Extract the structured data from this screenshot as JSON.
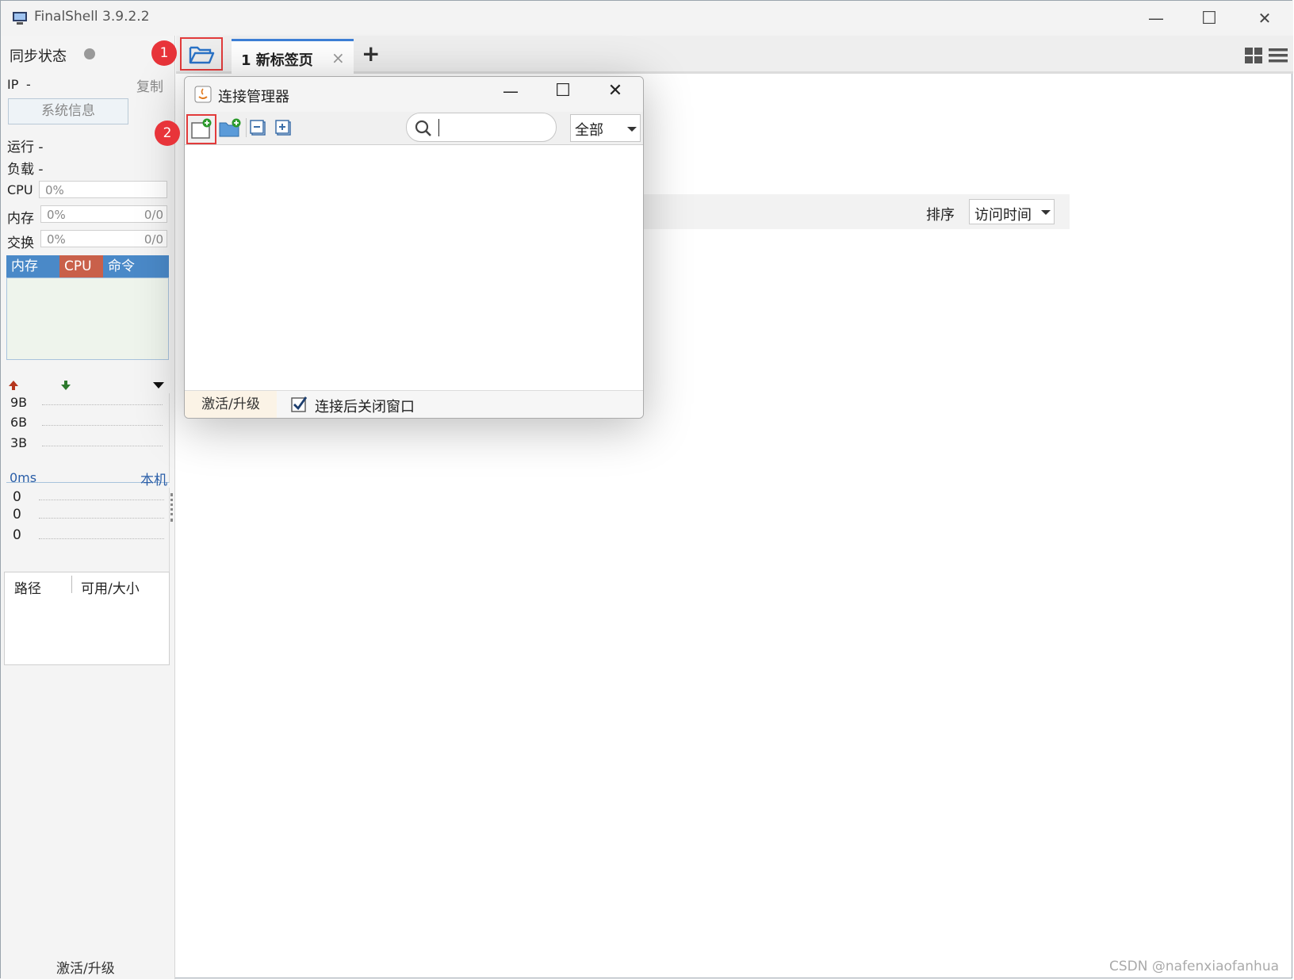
{
  "window": {
    "title": "FinalShell 3.9.2.2",
    "controls": {
      "minimize": "—",
      "maximize": "☐",
      "close": "✕"
    }
  },
  "sidebar": {
    "sync_status_label": "同步状态",
    "ip_label": "IP",
    "ip_value": "-",
    "copy_label": "复制",
    "system_info_button": "系统信息",
    "uptime_label": "运行 -",
    "load_label": "负载 -",
    "cpu_label": "CPU",
    "cpu_value": "0%",
    "mem_label": "内存",
    "mem_value": "0%",
    "mem_total": "0/0",
    "swap_label": "交换",
    "swap_value": "0%",
    "swap_total": "0/0",
    "monitor_tabs": [
      "内存",
      "CPU",
      "命令"
    ],
    "net_scale": [
      "9B",
      "6B",
      "3B"
    ],
    "latency_label": "0ms",
    "latency_target": "本机",
    "latency_values": [
      "0",
      "0",
      "0"
    ],
    "disk_columns": [
      "路径",
      "可用/大小"
    ],
    "activate_label": "激活/升级"
  },
  "tabs": {
    "open_badge": "1",
    "active_tab_label": "1 新标签页",
    "close_tab": "×",
    "add_tab": "+"
  },
  "content": {
    "sort_label": "排序",
    "sort_value": "访问时间"
  },
  "dialog": {
    "title": "连接管理器",
    "new_badge": "2",
    "search_placeholder": "",
    "filter_value": "全部",
    "activate_label": "激活/升级",
    "close_after_connect": "连接后关闭窗口"
  },
  "watermark": "CSDN @nafenxiaofanhua",
  "colors": {
    "mem_tab": "#4a89c8",
    "cpu_tab": "#c9604a",
    "cmd_tab": "#4a89c8",
    "highlight_red": "#e23b3b",
    "latency_blue": "#2a5ea8"
  }
}
